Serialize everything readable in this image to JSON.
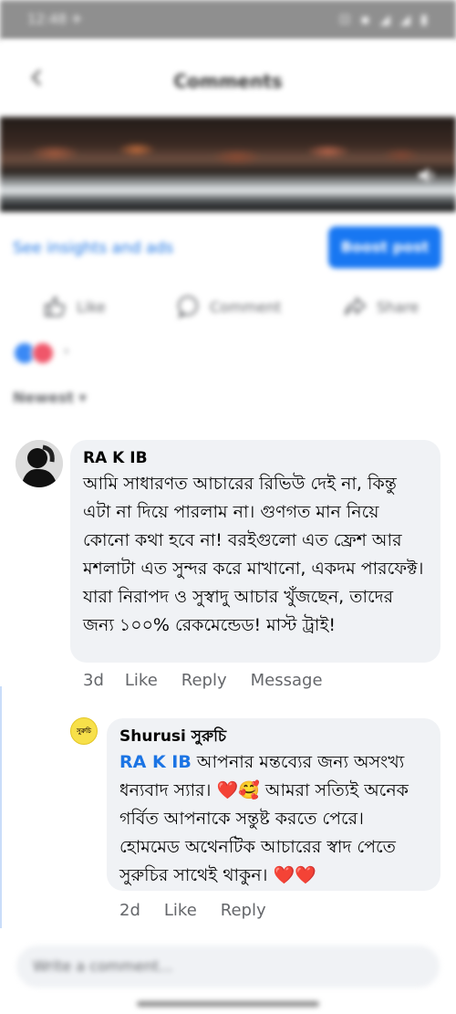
{
  "status_bar": {
    "time": "12:48 ✈",
    "icons": "⊡ ▪ ◢ ◢ ▮"
  },
  "header": {
    "title": "Comments"
  },
  "post": {
    "insights_link": "See insights and ads",
    "boost_label": "Boost post"
  },
  "actions": {
    "like": "Like",
    "comment": "Comment",
    "share": "Share"
  },
  "sort_label": "Newest ▾",
  "comments": [
    {
      "author": "RA K IB",
      "text": "আমি সাধারণত আচারের রিভিউ দেই না, কিন্তু এটা না দিয়ে পারলাম না। গুণগত মান নিয়ে কোনো কথা হবে না! বরইগুলো এত ফ্রেশ আর মশলাটা এত সুন্দর করে মাখানো, একদম পারফেক্ট। যারা নিরাপদ ও সুস্বাদু আচার খুঁজছেন, তাদের জন্য ১০০% রেকমেন্ডেড! মাস্ট ট্রাই!",
      "time": "3d",
      "like": "Like",
      "reply": "Reply",
      "message": "Message"
    }
  ],
  "reply": {
    "author": "Shurusi সুরুচি",
    "avatar_text": "সুরুচি",
    "mention": "RA K IB",
    "text_part1": " আপনার মন্তব্যের জন্য অসংখ্য ধন্যবাদ স্যার। ",
    "emoji1": "❤️🥰",
    "text_part2": " আমরা সত্যিই অনেক গর্বিত আপনাকে সন্তুষ্ট করতে পেরে। হোমমেড অথেনটিক আচারের স্বাদ পেতে সুরুচির সাথেই থাকুন। ",
    "emoji2": "❤️❤️",
    "time": "2d",
    "like": "Like",
    "reply": "Reply"
  },
  "composer": {
    "placeholder": "Write a comment..."
  },
  "colors": {
    "link": "#1b74e4",
    "bubble": "#f0f2f5",
    "meta": "#65676b"
  },
  "icons": [
    "back-arrow-icon",
    "volume-icon",
    "like-icon",
    "comment-icon",
    "share-icon"
  ]
}
